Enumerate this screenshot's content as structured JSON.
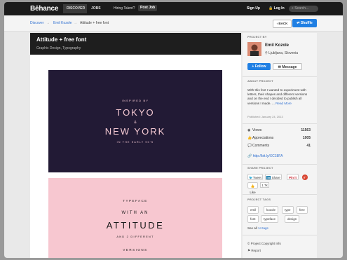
{
  "topbar": {
    "logo": "Bēhance",
    "nav": [
      "DISCOVER",
      "JOBS"
    ],
    "hiring": "Hiring Talent?",
    "post_job": "Post Job",
    "sign_up": "Sign Up",
    "log_in": "Log In",
    "search_placeholder": "Search..."
  },
  "breadcrumb": {
    "items": [
      "Discover",
      "Emil Kozole"
    ],
    "separator": "→",
    "current": "Attitude + free font"
  },
  "actions": {
    "back": "BACK",
    "shuffle": "Shuffle"
  },
  "project": {
    "title": "Attitude + free font",
    "fields": "Graphic Design, Typography"
  },
  "artwork1": {
    "line1": "INSPIRED BY",
    "line2": "TOKYO",
    "line3": "&",
    "line4": "NEW YORK",
    "line5": "IN THE EARLY 90'S"
  },
  "artwork2": {
    "line1": "TYPEFACE",
    "line2": "WITH AN",
    "line3": "ATTITUDE",
    "line4": "AND 2 DIFFERENT",
    "line5": "VERSIONS"
  },
  "sidebar": {
    "project_by_label": "PROJECT BY",
    "author_name": "Emil Kozole",
    "author_location": "Ljubljana, Slovenia",
    "follow": "Follow",
    "message": "Message",
    "about_label": "ABOUT PROJECT",
    "about_text": "With this font I wanted to experiment with letters, their shapes and different versions and on the end I decided to publish all versions I made. ...",
    "read_more": "Read More",
    "published": "Published: January 24, 2013",
    "stats": [
      {
        "label": "Views",
        "value": "11563",
        "icon": "eye-icon"
      },
      {
        "label": "Appreciations",
        "value": "1005",
        "icon": "thumb-icon"
      },
      {
        "label": "Comments",
        "value": "41",
        "icon": "comment-icon"
      }
    ],
    "short_link": "http://bit.ly/XC18FA",
    "share_label": "SHARE PROJECT",
    "share": {
      "tweet": "Tweet",
      "in_share": "Share",
      "pinit": "Pin it",
      "like": "Like",
      "like_count": "1.7k"
    },
    "tags_label": "PROJECT TAGS",
    "tags": [
      "emil",
      "kozole",
      "type",
      "free",
      "font",
      "typeface",
      "design"
    ],
    "see_all_prefix": "See all",
    "see_all_link": "14 tags",
    "copyright": "Project Copyright Info",
    "report": "Report"
  },
  "colors": {
    "accent": "#1f7fe3",
    "link": "#2e6fd1",
    "art_dark": "#221a35",
    "art_pink": "#f7c7d0",
    "art_text": "#f4c9d2"
  }
}
